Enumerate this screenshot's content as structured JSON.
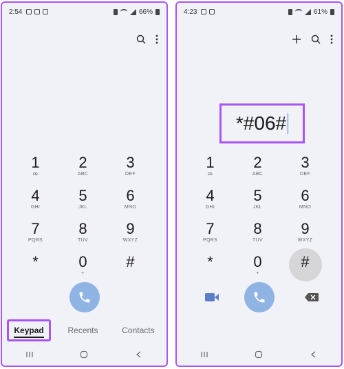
{
  "left": {
    "status": {
      "time": "2:54",
      "battery": "66%"
    },
    "keys": [
      {
        "num": "1",
        "sub": "ꝏ"
      },
      {
        "num": "2",
        "sub": "ABC"
      },
      {
        "num": "3",
        "sub": "DEF"
      },
      {
        "num": "4",
        "sub": "GHI"
      },
      {
        "num": "5",
        "sub": "JKL"
      },
      {
        "num": "6",
        "sub": "MNO"
      },
      {
        "num": "7",
        "sub": "PQRS"
      },
      {
        "num": "8",
        "sub": "TUV"
      },
      {
        "num": "9",
        "sub": "WXYZ"
      },
      {
        "num": "*",
        "sub": ""
      },
      {
        "num": "0",
        "sub": "+"
      },
      {
        "num": "#",
        "sub": ""
      }
    ],
    "tabs": {
      "keypad": "Keypad",
      "recents": "Recents",
      "contacts": "Contacts"
    }
  },
  "right": {
    "status": {
      "time": "4:23",
      "battery": "61%"
    },
    "display": "*#06#",
    "keys": [
      {
        "num": "1",
        "sub": "ꝏ"
      },
      {
        "num": "2",
        "sub": "ABC"
      },
      {
        "num": "3",
        "sub": "DEF"
      },
      {
        "num": "4",
        "sub": "GHI"
      },
      {
        "num": "5",
        "sub": "JKL"
      },
      {
        "num": "6",
        "sub": "MNO"
      },
      {
        "num": "7",
        "sub": "PQRS"
      },
      {
        "num": "8",
        "sub": "TUV"
      },
      {
        "num": "9",
        "sub": "WXYZ"
      },
      {
        "num": "*",
        "sub": ""
      },
      {
        "num": "0",
        "sub": "+"
      },
      {
        "num": "#",
        "sub": ""
      }
    ]
  },
  "colors": {
    "accent": "#a855f7",
    "call": "#8fb3e3",
    "background": "#f1f1f8"
  }
}
